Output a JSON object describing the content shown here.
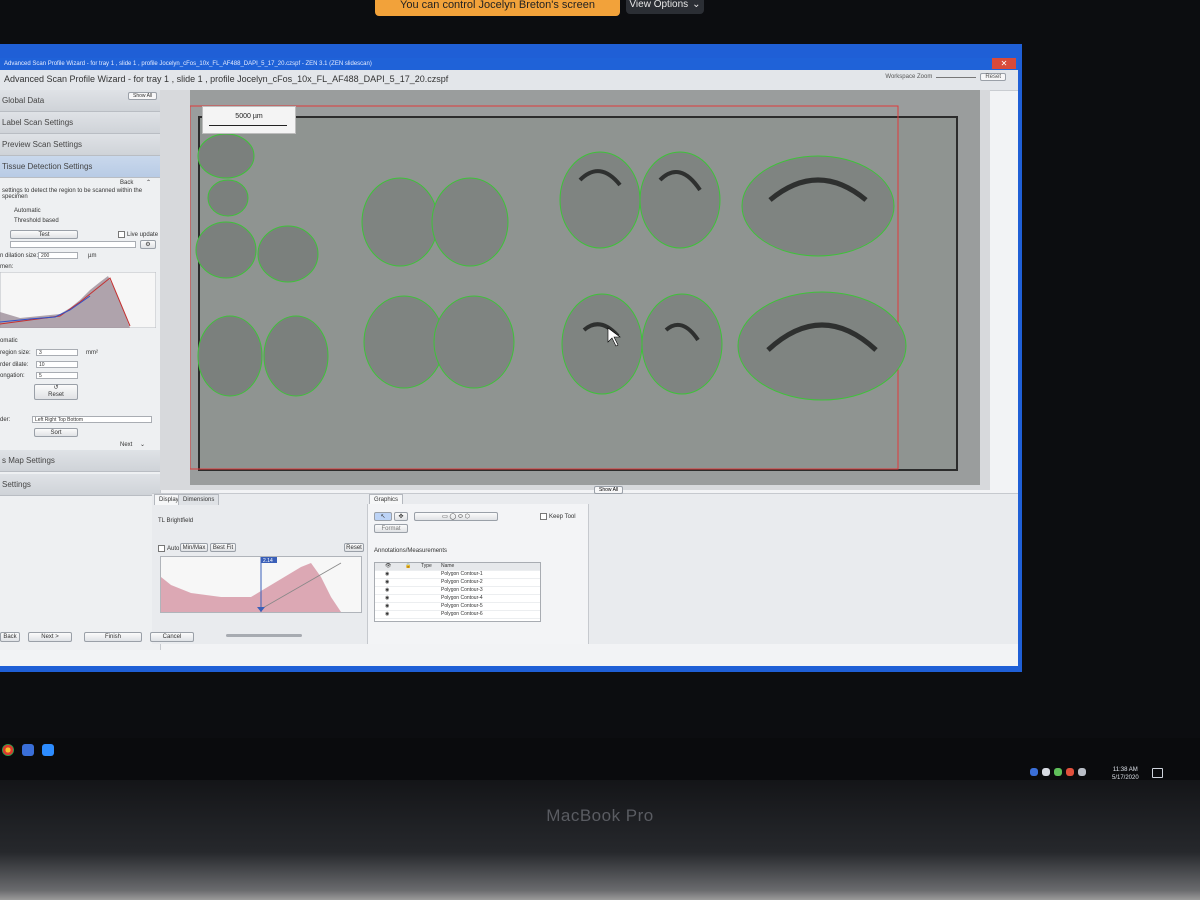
{
  "zoom": {
    "banner": "You can control Jocelyn Breton's screen",
    "view_options": "View Options"
  },
  "window": {
    "titlebar": "Advanced Scan Profile Wizard -  for tray 1 , slide 1 , profile Jocelyn_cFos_10x_FL_AF488_DAPI_5_17_20.czspf - ZEN 3.1 (ZEN slidescan)",
    "header_title": "Advanced Scan Profile Wizard -  for tray 1 , slide 1 , profile Jocelyn_cFos_10x_FL_AF488_DAPI_5_17_20.czspf",
    "workspace_zoom": "Workspace Zoom",
    "reset": "Reset",
    "show_all": "Show All"
  },
  "left_panel": {
    "sections": [
      "Global Data",
      "Label Scan Settings",
      "Preview Scan Settings",
      "Tissue Detection Settings"
    ],
    "back": "Back",
    "description": "settings to detect the region to be scanned within the specimen",
    "automatic": "Automatic",
    "threshold_based": "Threshold based",
    "test": "Test",
    "live_update": "Live update",
    "dilation_label": "n dilation size:",
    "dilation_value": "200",
    "dilation_unit": "µm",
    "histogram_label": "men:",
    "automatic2": "omatic",
    "region_size_label": "region size:",
    "region_size_value": "3",
    "region_size_unit": "mm²",
    "border_dilate_label": "rder dilate:",
    "border_dilate_value": "10",
    "elongation_label": "ongation:",
    "elongation_value": "5",
    "reset": "Reset",
    "order_label": "der:",
    "order_value": "Left Right Top Bottom",
    "sort": "Sort",
    "next": "Next",
    "sections_after": [
      "s Map Settings",
      "Settings"
    ]
  },
  "viewer": {
    "scale_bar": "5000 µm"
  },
  "display_pane": {
    "tabs": [
      "Display",
      "Dimensions"
    ],
    "channel": "TL Brightfield",
    "auto": "Auto",
    "min_max": "Min/Max",
    "best_fit": "Best Fit",
    "reset": "Reset",
    "histogram_marker": "2.14"
  },
  "graphics_pane": {
    "tab": "Graphics",
    "format": "Format",
    "keep_tool": "Keep Tool",
    "annotations_title": "Annotations/Measurements",
    "columns": [
      "Type",
      "Name"
    ],
    "rows": [
      "Polygon Contour-1",
      "Polygon Contour-2",
      "Polygon Contour-3",
      "Polygon Contour-4",
      "Polygon Contour-5",
      "Polygon Contour-6"
    ]
  },
  "footer": {
    "back": "Back",
    "next": "Next >",
    "finish": "Finish",
    "cancel": "Cancel"
  },
  "taskbar": {
    "time": "11:38 AM",
    "date": "5/17/2020"
  },
  "laptop": {
    "brand": "MacBook Pro"
  },
  "colors": {
    "accent_blue": "#1f62d8",
    "zoom_orange": "#f2a23a",
    "contour_green": "#3fc23a",
    "boundary_red": "#e03a3a"
  }
}
